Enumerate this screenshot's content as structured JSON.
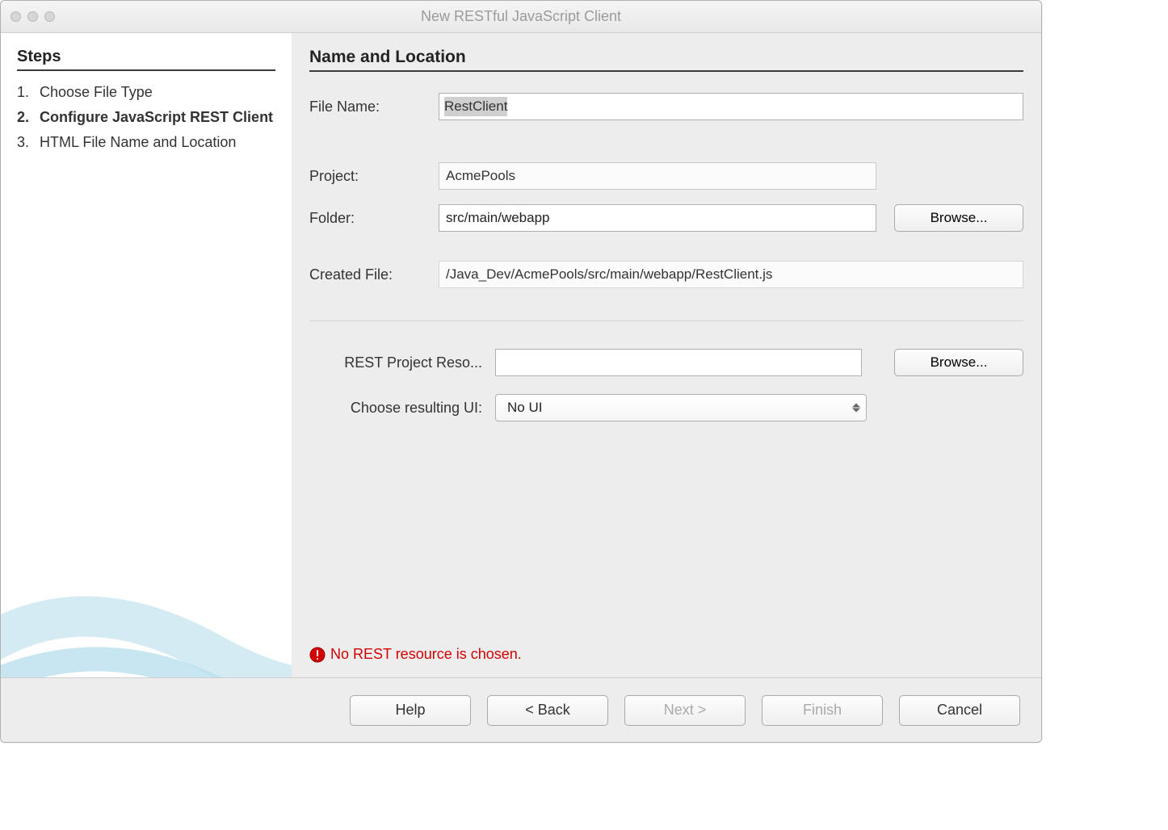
{
  "window": {
    "title": "New RESTful JavaScript Client"
  },
  "steps": {
    "heading": "Steps",
    "items": [
      {
        "num": "1.",
        "label": "Choose File Type",
        "current": false
      },
      {
        "num": "2.",
        "label": "Configure JavaScript REST Client",
        "current": true
      },
      {
        "num": "3.",
        "label": "HTML File Name and Location",
        "current": false
      }
    ]
  },
  "main": {
    "heading": "Name and Location",
    "file_name_label": "File Name:",
    "file_name_value": "RestClient",
    "project_label": "Project:",
    "project_value": "AcmePools",
    "folder_label": "Folder:",
    "folder_value": "src/main/webapp",
    "browse_label": "Browse...",
    "created_file_label": "Created File:",
    "created_file_value": "/Java_Dev/AcmePools/src/main/webapp/RestClient.js",
    "rest_resource_label": "REST Project Reso...",
    "rest_resource_value": "",
    "choose_ui_label": "Choose resulting UI:",
    "choose_ui_value": "No UI",
    "error_message": "No REST resource is chosen."
  },
  "buttons": {
    "help": "Help",
    "back": "< Back",
    "next": "Next >",
    "finish": "Finish",
    "cancel": "Cancel"
  }
}
